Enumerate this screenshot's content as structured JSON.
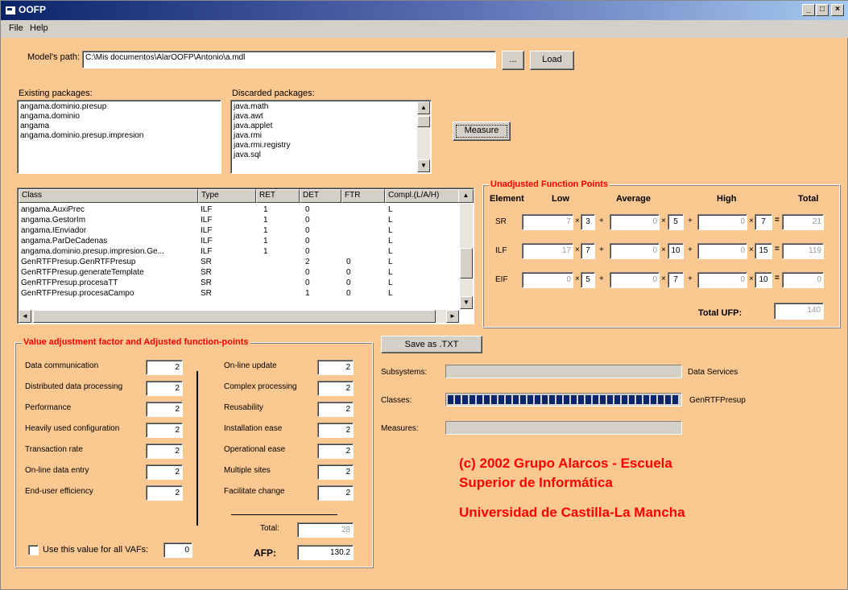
{
  "window": {
    "title": "OOFP"
  },
  "menu": {
    "file": "File",
    "help": "Help"
  },
  "model_path": {
    "label": "Model's path:",
    "value": "C:\\Mis documentos\\AlarOOFP\\Antonio\\a.mdl",
    "browse": "...",
    "load": "Load"
  },
  "packages": {
    "existing_label": "Existing packages:",
    "existing": [
      "angama.dominio.presup",
      "angama.dominio",
      "angama",
      "angama.dominio.presup.impresion"
    ],
    "discarded_label": "Discarded packages:",
    "discarded": [
      "java.math",
      "java.awt",
      "java.applet",
      "java.rmi",
      "java.rmi.registry",
      "java.sql"
    ],
    "measure_label": "Measure"
  },
  "class_table": {
    "headers": [
      "Class",
      "Type",
      "RET",
      "DET",
      "FTR",
      "Compl.(L/A/H)"
    ],
    "rows": [
      [
        "angama.AuxiPrec",
        "ILF",
        "1",
        "0",
        "",
        "L"
      ],
      [
        "angama.GestorIm",
        "ILF",
        "1",
        "0",
        "",
        "L"
      ],
      [
        "angama.IEnviador",
        "ILF",
        "1",
        "0",
        "",
        "L"
      ],
      [
        "angama.ParDeCadenas",
        "ILF",
        "1",
        "0",
        "",
        "L"
      ],
      [
        "angama.dominio.presup.impresion.Ge...",
        "ILF",
        "1",
        "0",
        "",
        "L"
      ],
      [
        "GenRTFPresup.GenRTFPresup",
        "SR",
        "",
        "2",
        "0",
        "L"
      ],
      [
        "GenRTFPresup.generateTemplate",
        "SR",
        "",
        "0",
        "0",
        "L"
      ],
      [
        "GenRTFPresup.procesaTT",
        "SR",
        "",
        "0",
        "0",
        "L"
      ],
      [
        "GenRTFPresup.procesaCampo",
        "SR",
        "",
        "1",
        "0",
        "L"
      ]
    ]
  },
  "ufp": {
    "legend": "Unadjusted Function Points",
    "headers": {
      "element": "Element",
      "low": "Low",
      "average": "Average",
      "high": "High",
      "total": "Total"
    },
    "rows": [
      {
        "element": "SR",
        "low_count": "7",
        "low_w": "3",
        "avg_count": "0",
        "avg_w": "5",
        "high_count": "0",
        "high_w": "7",
        "total": "21"
      },
      {
        "element": "ILF",
        "low_count": "17",
        "low_w": "7",
        "avg_count": "0",
        "avg_w": "10",
        "high_count": "0",
        "high_w": "15",
        "total": "119"
      },
      {
        "element": "EIF",
        "low_count": "0",
        "low_w": "5",
        "avg_count": "0",
        "avg_w": "7",
        "high_count": "0",
        "high_w": "10",
        "total": "0"
      }
    ],
    "total_label": "Total UFP:",
    "total_value": "140"
  },
  "vaf": {
    "legend": "Value adjustment factor and Adjusted function-points",
    "left": [
      {
        "label": "Data communication",
        "value": "2"
      },
      {
        "label": "Distributed data processing",
        "value": "2"
      },
      {
        "label": "Performance",
        "value": "2"
      },
      {
        "label": "Heavily used configuration",
        "value": "2"
      },
      {
        "label": "Transaction rate",
        "value": "2"
      },
      {
        "label": "On-line data entry",
        "value": "2"
      },
      {
        "label": "End-user efficiency",
        "value": "2"
      }
    ],
    "right": [
      {
        "label": "On-line update",
        "value": "2"
      },
      {
        "label": "Complex processing",
        "value": "2"
      },
      {
        "label": "Reusability",
        "value": "2"
      },
      {
        "label": "Installation ease",
        "value": "2"
      },
      {
        "label": "Operational ease",
        "value": "2"
      },
      {
        "label": "Multiple sites",
        "value": "2"
      },
      {
        "label": "Facilitate change",
        "value": "2"
      }
    ],
    "total_label": "Total:",
    "total_value": "28",
    "afp_label": "AFP:",
    "afp_value": "130.2",
    "use_all_label": "Use this value for all VAFs:",
    "use_all_value": "0"
  },
  "save_label": "Save as .TXT",
  "progress": {
    "subsystems_label": "Subsystems:",
    "subsystems_text": "Data Services",
    "subsystems_fill": 0,
    "classes_label": "Classes:",
    "classes_text": "GenRTFPresup",
    "classes_fill": 1,
    "measures_label": "Measures:",
    "measures_fill": 0
  },
  "credits": {
    "line1": "(c) 2002 Grupo Alarcos - Escuela",
    "line2": "Superior de Informática",
    "line3": "Universidad de Castilla-La Mancha"
  }
}
